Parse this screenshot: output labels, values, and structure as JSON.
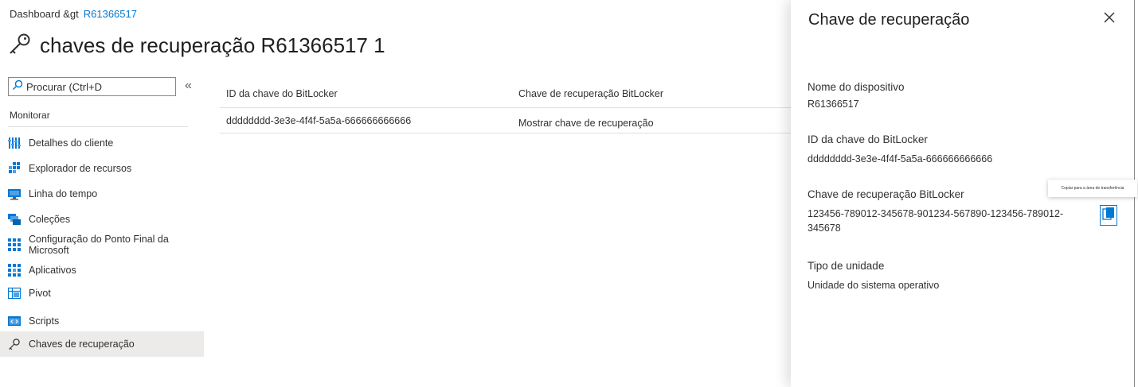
{
  "breadcrumb": {
    "root": "Dashboard &gt",
    "current": "R61366517"
  },
  "page": {
    "title": "chaves de recuperação R61366517 1"
  },
  "search": {
    "placeholder": "Procurar (Ctrl+D"
  },
  "sidebar": {
    "section": "Monitorar",
    "items": [
      {
        "label": "Detalhes do cliente",
        "icon": "client-details-icon"
      },
      {
        "label": "Explorador de recursos",
        "icon": "resource-explorer-icon"
      },
      {
        "label": "Linha do tempo",
        "icon": "timeline-icon"
      },
      {
        "label": "Coleções",
        "icon": "collections-icon"
      },
      {
        "label": "Configuração do Ponto Final da Microsoft",
        "icon": "endpoint-config-icon"
      },
      {
        "label": "Aplicativos",
        "icon": "apps-icon"
      },
      {
        "label": "Pivot",
        "icon": "pivot-icon"
      },
      {
        "label": "Scripts",
        "icon": "scripts-icon"
      },
      {
        "label": "Chaves de recuperação",
        "icon": "key-icon",
        "active": true
      }
    ]
  },
  "table": {
    "headers": [
      "ID da chave do BitLocker",
      "Chave de recuperação BitLocker"
    ],
    "rows": [
      {
        "key_id": "dddddddd-3e3e-4f4f-5a5a-666666666666",
        "action": "Mostrar chave de recuperação"
      }
    ]
  },
  "panel": {
    "title": "Chave de recuperação",
    "device_label": "Nome do dispositivo",
    "device_value": "R61366517",
    "keyid_label": "ID da chave do BitLocker",
    "keyid_value": "dddddddd-3e3e-4f4f-5a5a-666666666666",
    "key_label": "Chave de recuperação BitLocker",
    "key_value_line1": "123456-789012-345678-901234-567890-123456-789012-",
    "key_value_line2": "345678",
    "drive_label": "Tipo de unidade",
    "drive_value": "Unidade do sistema operativo",
    "copy_tooltip": "Copiar para a área de transferência"
  },
  "colors": {
    "accent": "#0078d4",
    "active_bg": "#edebe9"
  }
}
